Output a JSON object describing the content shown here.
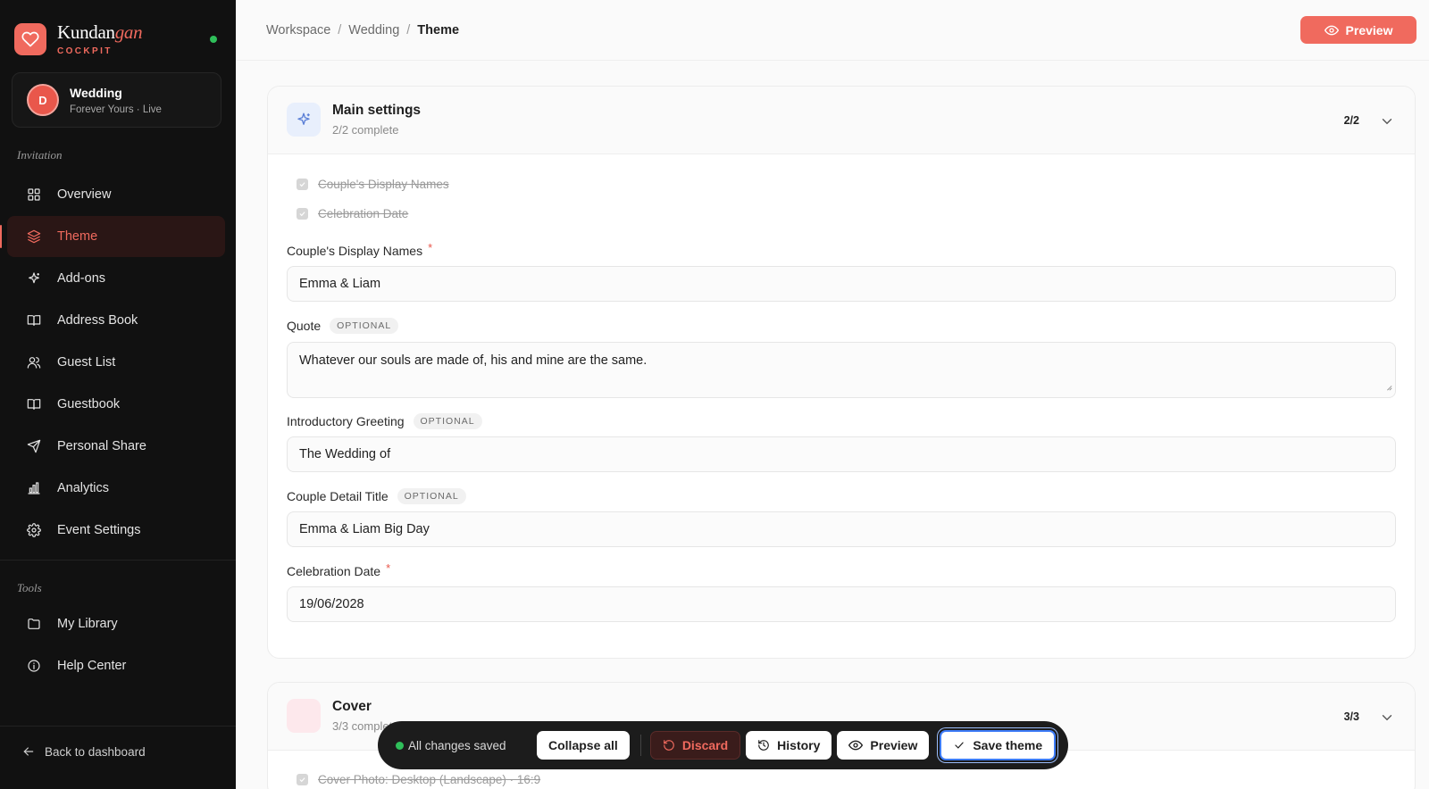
{
  "brand": {
    "name_main": "Kundan",
    "name_accent": "gan",
    "subtitle": "COCKPIT"
  },
  "event": {
    "avatar_initial": "D",
    "title": "Wedding",
    "meta": "Forever Yours · Live"
  },
  "sidebar": {
    "section_invitation": "Invitation",
    "items": [
      {
        "label": "Overview",
        "icon": "grid-icon"
      },
      {
        "label": "Theme",
        "icon": "layers-icon",
        "active": true
      },
      {
        "label": "Add-ons",
        "icon": "sparkle-icon"
      },
      {
        "label": "Address Book",
        "icon": "book-icon"
      },
      {
        "label": "Guest List",
        "icon": "users-icon"
      },
      {
        "label": "Guestbook",
        "icon": "book-open-icon"
      },
      {
        "label": "Personal Share",
        "icon": "send-icon"
      },
      {
        "label": "Analytics",
        "icon": "bar-chart-icon"
      },
      {
        "label": "Event Settings",
        "icon": "gear-icon"
      }
    ],
    "section_tools": "Tools",
    "tools": [
      {
        "label": "My Library",
        "icon": "folder-icon"
      },
      {
        "label": "Help Center",
        "icon": "info-icon"
      }
    ],
    "back_label": "Back to dashboard"
  },
  "header": {
    "breadcrumb": [
      "Workspace",
      "Wedding",
      "Theme"
    ],
    "preview_label": "Preview"
  },
  "main_settings": {
    "title": "Main settings",
    "subtitle": "2/2 complete",
    "count": "2/2",
    "checklist": [
      "Couple's Display Names",
      "Celebration Date"
    ],
    "fields": {
      "couple_names": {
        "label": "Couple's Display Names",
        "required_mark": "*",
        "value": "Emma & Liam"
      },
      "quote": {
        "label": "Quote",
        "badge": "OPTIONAL",
        "value": "Whatever our souls are made of, his and mine are the same."
      },
      "greeting": {
        "label": "Introductory Greeting",
        "badge": "OPTIONAL",
        "value": "The Wedding of"
      },
      "detail_title": {
        "label": "Couple Detail Title",
        "badge": "OPTIONAL",
        "value": "Emma & Liam Big Day"
      },
      "date": {
        "label": "Celebration Date",
        "required_mark": "*",
        "value": "19/06/2028"
      }
    }
  },
  "cover": {
    "title": "Cover",
    "subtitle": "3/3 complete",
    "count": "3/3",
    "checklist": [
      "Cover Photo: Desktop (Landscape) · 16:9"
    ]
  },
  "actionbar": {
    "status": "All changes saved",
    "collapse_label": "Collapse all",
    "discard_label": "Discard",
    "history_label": "History",
    "preview_label": "Preview",
    "save_label": "Save theme"
  },
  "colors": {
    "accent": "#f06a5e",
    "sidebar_bg": "#111111",
    "success": "#2fbf5a",
    "focus": "#3d7bf7"
  }
}
